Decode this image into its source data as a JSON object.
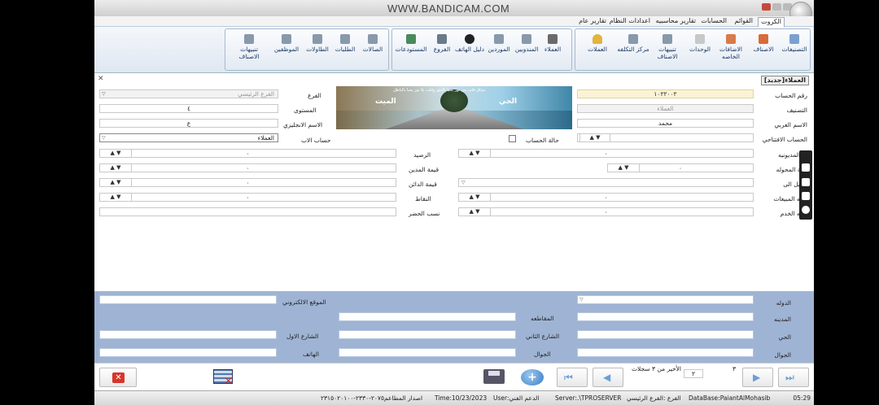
{
  "watermark": "WWW.BANDICAM.COM",
  "menu": {
    "tabs": [
      {
        "label": "الكروت",
        "active": true
      },
      {
        "label": "القوائم"
      },
      {
        "label": "الحسابات"
      },
      {
        "label": "تقارير محاسبيه"
      },
      {
        "label": "اعدادات النظام"
      },
      {
        "label": "تقارير عام"
      }
    ]
  },
  "ribbon": {
    "group1": [
      "التصنيفات",
      "الاصناف",
      "الاضافات الخاصه",
      "الوحدات",
      "تنبيهات الاصناف",
      "مركز التكلفه",
      "العملات"
    ],
    "group2": [
      "العملاء",
      "المندوبين",
      "الموردين",
      "دليل الهاتف",
      "الفروع",
      "المستودعات"
    ],
    "group3": [
      "الصالات",
      "الطلبات",
      "الطاولات",
      "الموظفين",
      "تنبيهات الاصناف"
    ]
  },
  "form": {
    "title": "العملاء[جديد]",
    "account_no_label": "رقم الحساب",
    "account_no": "١٠٢٢٠٠٢",
    "category_label": "التصنيف",
    "category": "العملاء",
    "arabic_name_label": "الاسم العربي",
    "arabic_name": "محمد",
    "opening_label": "الحساب الافتتاحي",
    "credit_limit_label": "حد المديونيه",
    "transferred_label": "قيمة المحوله",
    "transfer_to_label": "ترحيل الى",
    "sales_pct_label": "نسبه المبيعات",
    "service_pct_label": "نسبه الخدم",
    "account_status_label": "حالة الحساب",
    "branch_label": "الفرع",
    "branch": "الفرع الرئيسي",
    "level_label": "المستوى",
    "level": "٤",
    "english_name_label": "الاسم الانجليزي",
    "english_name": "ع",
    "parent_label": "حساب الاب",
    "parent": "العملاء",
    "balance_label": "الرصيد",
    "debit_label": "قيمة المدين",
    "credit_value_label": "قيمة الدائن",
    "points_label": "النقاط",
    "attendance_label": "نسب الحضر",
    "zero": "٠",
    "banner_left": "الحي",
    "banner_right": "الميت",
    "banner_caption": "ميثاق قلب من نور يحيا بالحق وقلب بلا نور يحيا بالباطل"
  },
  "address": {
    "country_label": "الدوله",
    "city_label": "المدينه",
    "district_label": "الحي",
    "mobile_label": "الجوال",
    "region_label": "المقاطعه",
    "street2_label": "الشارع الثاني",
    "mobile2_label": "الجوال",
    "website_label": "الموقع الالكتروني",
    "street1_label": "الشارع الاول",
    "phone_label": "الهاتف"
  },
  "nav": {
    "page_no": "٢",
    "page_total": "٣",
    "records_text": "الأخير من ٣ سجلات"
  },
  "status": {
    "time": "05:29",
    "database": "DataBase:PaiantAlMohasib",
    "branch": "الفرع :الفرع الرئيسي",
    "server": "Server:.\\TPROSERVER",
    "user": "User:الدعم الفني",
    "date": "Time:10/23/2023",
    "version": "اصدار المطاعم٢٠٧٥-٢٣٣٠-٢٣١٥٠٢٠١٠٠"
  }
}
